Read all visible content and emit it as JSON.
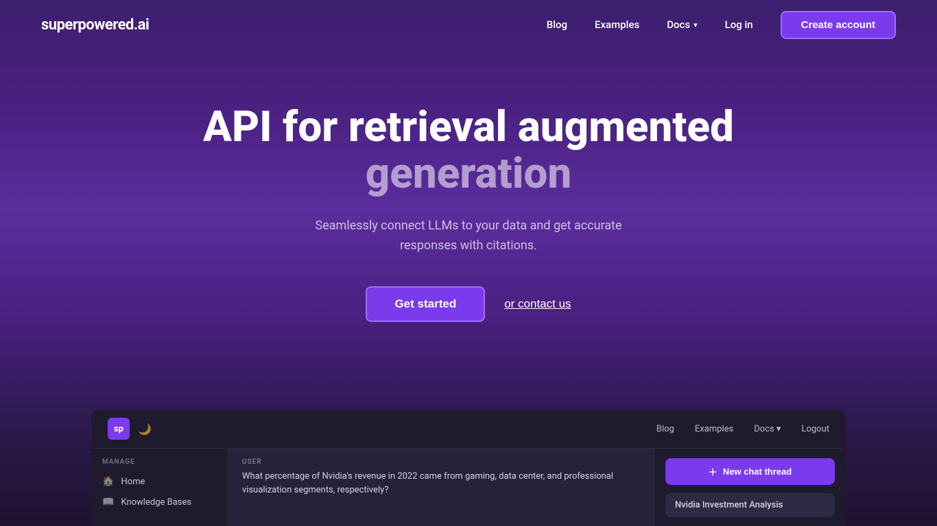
{
  "brand": {
    "name": "superpowered.ai",
    "logo_text": "sp"
  },
  "navbar": {
    "blog_label": "Blog",
    "examples_label": "Examples",
    "docs_label": "Docs",
    "login_label": "Log in",
    "create_account_label": "Create account"
  },
  "hero": {
    "title_line1": "API for retrieval augmented",
    "title_line2": "generation",
    "subtitle": "Seamlessly connect LLMs to your data and get accurate responses with citations.",
    "get_started_label": "Get started",
    "contact_label": "or contact us"
  },
  "dashboard": {
    "topbar": {
      "blog_label": "Blog",
      "examples_label": "Examples",
      "docs_label": "Docs",
      "logout_label": "Logout"
    },
    "sidebar": {
      "manage_label": "MANAGE",
      "home_label": "Home",
      "knowledge_bases_label": "Knowledge Bases"
    },
    "chat": {
      "user_label": "USER",
      "message": "What percentage of Nvidia's revenue in 2022 came from gaming, data center, and professional visualization segments, respectively?"
    },
    "right_panel": {
      "new_chat_label": "New chat thread",
      "nvidia_card_label": "Nvidia Investment Analysis"
    }
  }
}
